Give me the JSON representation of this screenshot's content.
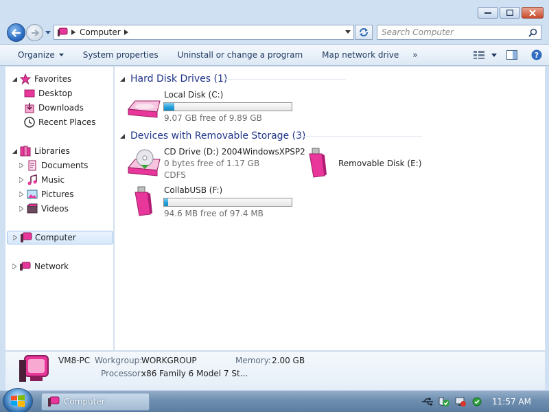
{
  "window": {
    "title": "Computer"
  },
  "address": {
    "path": "Computer",
    "search_placeholder": "Search Computer"
  },
  "toolbar": {
    "organize": "Organize",
    "system_properties": "System properties",
    "uninstall": "Uninstall or change a program",
    "map_drive": "Map network drive",
    "more": "»"
  },
  "navpane": {
    "favorites": "Favorites",
    "desktop": "Desktop",
    "downloads": "Downloads",
    "recent": "Recent Places",
    "libraries": "Libraries",
    "documents": "Documents",
    "music": "Music",
    "pictures": "Pictures",
    "videos": "Videos",
    "computer": "Computer",
    "network": "Network"
  },
  "groups": {
    "hdd": "Hard Disk Drives (1)",
    "removable": "Devices with Removable Storage (3)"
  },
  "drives": {
    "c": {
      "name": "Local Disk (C:)",
      "free": "9.07 GB free of 9.89 GB",
      "used_fraction": 0.08
    },
    "d": {
      "name": "CD Drive (D:) 2004WindowsXPSP2",
      "free": "0 bytes free of 1.17 GB",
      "fs": "CDFS"
    },
    "e": {
      "name": "Removable Disk (E:)"
    },
    "f": {
      "name": "CollabUSB (F:)",
      "free": "94.6 MB free of 97.4 MB",
      "used_fraction": 0.03
    }
  },
  "details": {
    "pc_name": "VM8-PC",
    "workgroup_label": "Workgroup:",
    "workgroup": "WORKGROUP",
    "memory_label": "Memory:",
    "memory": "2.00 GB",
    "processor_label": "Processor:",
    "processor": "x86 Family 6 Model 7 St..."
  },
  "taskbar": {
    "task": "Computer",
    "time": "11:57 AM"
  },
  "colors": {
    "accent_pink": "#e8369a",
    "progress": "#26a0da",
    "header_blue": "#1e3287"
  }
}
